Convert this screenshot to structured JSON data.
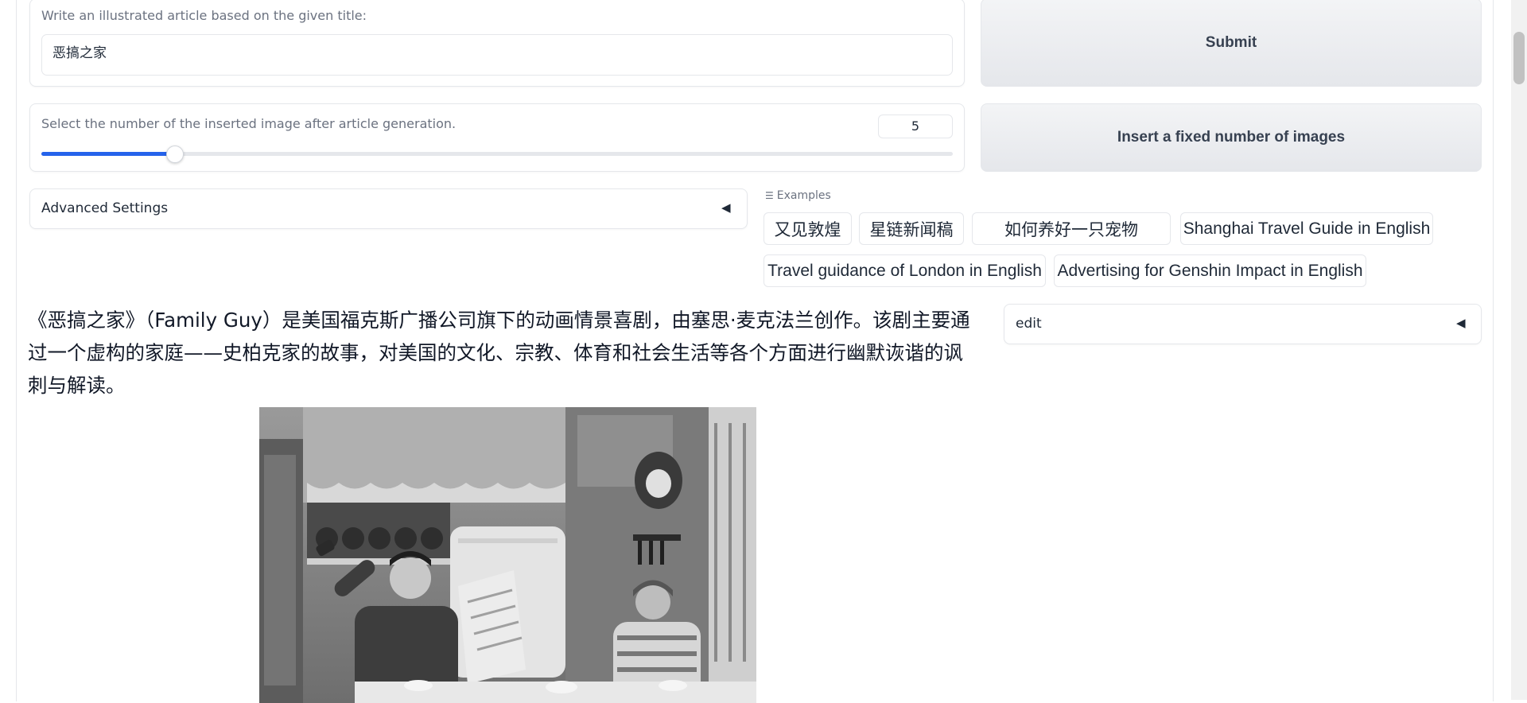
{
  "title_input": {
    "label": "Write an illustrated article based on the given title:",
    "value": "恶搞之家"
  },
  "submit_button": {
    "label": "Submit"
  },
  "image_count": {
    "label": "Select the number of the inserted image after article generation.",
    "value": "5",
    "slider_fraction": 0.147
  },
  "insert_button": {
    "label": "Insert a fixed number of images"
  },
  "advanced_settings": {
    "label": "Advanced Settings",
    "toggle_glyph": "◀"
  },
  "examples": {
    "label": "Examples",
    "items": [
      "又见敦煌",
      "星链新闻稿",
      "如何养好一只宠物",
      "Shanghai Travel Guide in English",
      "Travel guidance of London in English",
      "Advertising for Genshin Impact in English"
    ]
  },
  "edit_panel": {
    "label": "edit",
    "toggle_glyph": "◀"
  },
  "article": {
    "paragraph": "《恶搞之家》（Family Guy）是美国福克斯广播公司旗下的动画情景喜剧，由塞思·麦克法兰创作。该剧主要通过一个虚构的家庭——史柏克家的故事，对美国的文化、宗教、体育和社会生活等各个方面进行幽默诙谐的讽刺与解读。"
  },
  "colors": {
    "accent": "#2563eb",
    "border": "#e5e7eb",
    "button_bg": "#e5e7eb"
  }
}
